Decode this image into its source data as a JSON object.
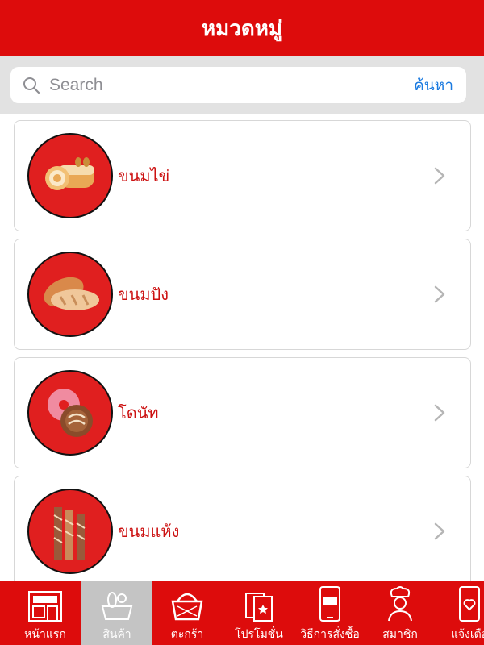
{
  "header": {
    "title": "หมวดหมู่"
  },
  "search": {
    "placeholder": "Search",
    "button_label": "ค้นหา"
  },
  "categories": [
    {
      "label": "ขนมไข่"
    },
    {
      "label": "ขนมปัง"
    },
    {
      "label": "โดนัท"
    },
    {
      "label": "ขนมแห้ง"
    }
  ],
  "tabs": [
    {
      "label": "หน้าแรก",
      "icon": "bakery-shop-icon"
    },
    {
      "label": "สินค้า",
      "icon": "bread-basket-icon",
      "active": true
    },
    {
      "label": "ตะกร้า",
      "icon": "basket-icon"
    },
    {
      "label": "โปรโมชั่น",
      "icon": "promotion-cards-icon"
    },
    {
      "label": "วิธีการสั่งซื้อ",
      "icon": "phone-buy-icon"
    },
    {
      "label": "สมาชิก",
      "icon": "chef-icon"
    },
    {
      "label": "แจ้งเตือ",
      "icon": "phone-notification-icon"
    }
  ],
  "colors": {
    "primary": "#dd0c0c",
    "link": "#1a7ae0",
    "label": "#cc1111",
    "active_tab": "#c4c4c4"
  }
}
